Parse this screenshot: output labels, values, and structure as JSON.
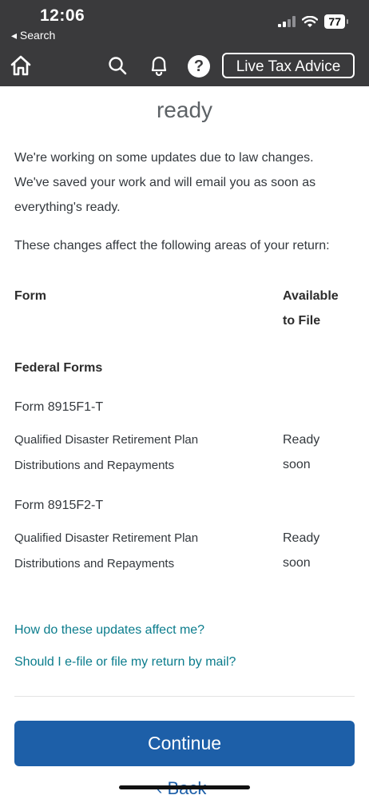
{
  "status": {
    "time": "12:06",
    "back_label": "◂ Search",
    "battery": "77"
  },
  "nav": {
    "help_glyph": "?",
    "live_tax_label": "Live Tax Advice"
  },
  "main": {
    "heading": "ready",
    "para1_line1": "We're working on some updates due to law changes.",
    "para1_line2": "We've saved your work and will email you as soon as",
    "para1_line3": "everything's ready.",
    "para2": "These changes affect the following areas of your return:"
  },
  "table": {
    "col_form": "Form",
    "col_available_line1": "Available",
    "col_available_line2": "to File",
    "section": "Federal Forms",
    "rows": [
      {
        "form": "Form 8915F1-T",
        "desc_line1": "Qualified Disaster Retirement Plan",
        "desc_line2": "Distributions and Repayments",
        "status_line1": "Ready",
        "status_line2": "soon"
      },
      {
        "form": "Form 8915F2-T",
        "desc_line1": "Qualified Disaster Retirement Plan",
        "desc_line2": "Distributions and Repayments",
        "status_line1": "Ready",
        "status_line2": "soon"
      }
    ]
  },
  "links": {
    "updates": "How do these updates affect me?",
    "efile": "Should I e-file or file my return by mail?"
  },
  "actions": {
    "continue": "Continue",
    "back": "Back"
  },
  "colors": {
    "topbar": "#3a3a3c",
    "primary": "#1d5fa8",
    "link": "#0a7c8c"
  }
}
